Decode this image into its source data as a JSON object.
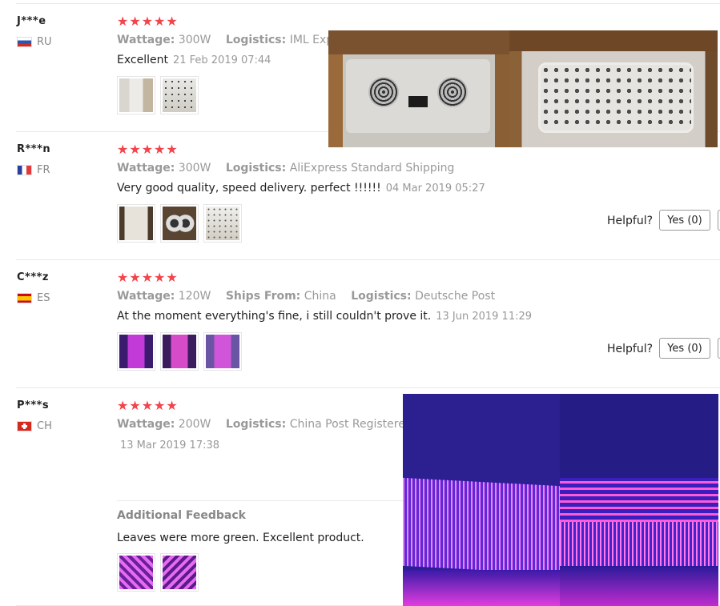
{
  "reviews": [
    {
      "user": "J***e",
      "country": "RU",
      "stars": "★★★★★",
      "attrs": [
        {
          "label": "Wattage:",
          "value": "300W"
        },
        {
          "label": "Logistics:",
          "value": "IML Express"
        }
      ],
      "text": "Excellent",
      "date": "21 Feb 2019 07:44"
    },
    {
      "user": "R***n",
      "country": "FR",
      "stars": "★★★★★",
      "attrs": [
        {
          "label": "Wattage:",
          "value": "300W"
        },
        {
          "label": "Logistics:",
          "value": "AliExpress Standard Shipping"
        }
      ],
      "text": "Very good quality, speed delivery. perfect !!!!!!",
      "date": "04 Mar 2019 05:27",
      "helpful_label": "Helpful?",
      "yes_label": "Yes (0)"
    },
    {
      "user": "C***z",
      "country": "ES",
      "stars": "★★★★★",
      "attrs": [
        {
          "label": "Wattage:",
          "value": "120W"
        },
        {
          "label": "Ships From:",
          "value": "China"
        },
        {
          "label": "Logistics:",
          "value": "Deutsche Post"
        }
      ],
      "text": "At the moment everything's fine, i still couldn't prove it.",
      "date": "13 Jun 2019 11:29",
      "helpful_label": "Helpful?",
      "yes_label": "Yes (0)"
    },
    {
      "user": "P***s",
      "country": "CH",
      "stars": "★★★★★",
      "attrs": [
        {
          "label": "Wattage:",
          "value": "200W"
        },
        {
          "label": "Logistics:",
          "value": "China Post Registered Air M"
        }
      ],
      "date": "13 Mar 2019 17:38",
      "additional_label": "Additional Feedback",
      "additional_text": "Leaves were more green. Excellent product."
    }
  ],
  "colors": {
    "star": "#f3434c",
    "muted": "#999999",
    "text": "#222222"
  }
}
